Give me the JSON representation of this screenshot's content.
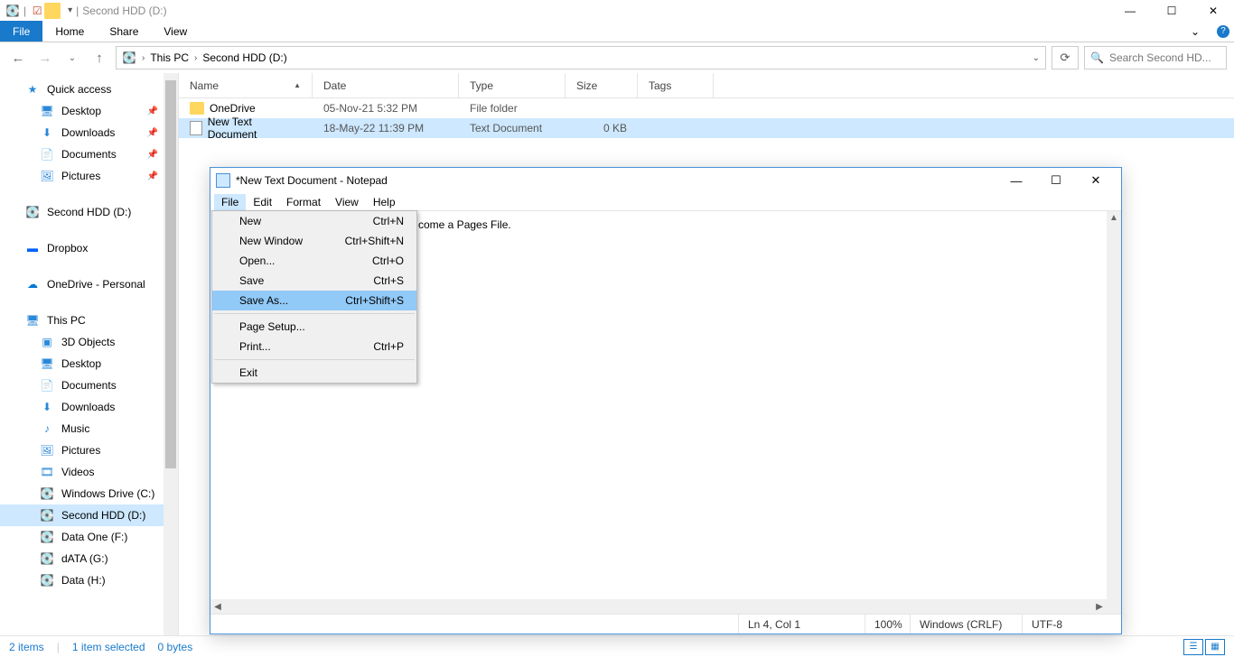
{
  "window": {
    "title": "Second HDD (D:)",
    "min": "—",
    "max": "☐",
    "close": "✕"
  },
  "ribbon": {
    "file": "File",
    "home": "Home",
    "share": "Share",
    "view": "View",
    "dropdown": "⌄"
  },
  "nav": {
    "back": "←",
    "forward": "→",
    "up": "↑",
    "dropdown": "⌄"
  },
  "breadcrumb": {
    "root": "This PC",
    "chev": "›",
    "leaf": "Second HDD (D:)",
    "refresh": "⟳"
  },
  "search": {
    "icon": "🔍",
    "placeholder": "Search Second HD..."
  },
  "cols": {
    "name": "Name",
    "date": "Date",
    "type": "Type",
    "size": "Size",
    "tags": "Tags",
    "arrow": "▲"
  },
  "rows": [
    {
      "name": "OneDrive",
      "date": "05-Nov-21 5:32 PM",
      "type": "File folder",
      "size": "",
      "kind": "folder"
    },
    {
      "name": "New Text Document",
      "date": "18-May-22 11:39 PM",
      "type": "Text Document",
      "size": "0 KB",
      "kind": "file",
      "selected": true
    }
  ],
  "tree": {
    "quick": "Quick access",
    "desktop": "Desktop",
    "downloads": "Downloads",
    "documents": "Documents",
    "pictures": "Pictures",
    "second": "Second HDD (D:)",
    "dropbox": "Dropbox",
    "onedrive": "OneDrive - Personal",
    "thispc": "This PC",
    "tpc": {
      "objs": "3D Objects",
      "desktop": "Desktop",
      "docs": "Documents",
      "dl": "Downloads",
      "music": "Music",
      "pics": "Pictures",
      "vids": "Videos",
      "c": "Windows Drive (C:)",
      "d": "Second HDD (D:)",
      "f": "Data One (F:)",
      "g": "dATA (G:)",
      "h": "Data (H:)"
    }
  },
  "status": {
    "count": "2 items",
    "sel": "1 item selected",
    "bytes": "0 bytes"
  },
  "notepad": {
    "title": "*New Text Document - Notepad",
    "menu": {
      "file": "File",
      "edit": "Edit",
      "format": "Format",
      "view": "View",
      "help": "Help"
    },
    "body_visible": "come a Pages File.",
    "status": {
      "pos": "Ln 4, Col 1",
      "zoom": "100%",
      "eol": "Windows (CRLF)",
      "enc": "UTF-8"
    }
  },
  "dropdown": [
    {
      "label": "New",
      "shortcut": "Ctrl+N"
    },
    {
      "label": "New Window",
      "shortcut": "Ctrl+Shift+N"
    },
    {
      "label": "Open...",
      "shortcut": "Ctrl+O"
    },
    {
      "label": "Save",
      "shortcut": "Ctrl+S"
    },
    {
      "label": "Save As...",
      "shortcut": "Ctrl+Shift+S",
      "hl": true
    },
    {
      "sep": true
    },
    {
      "label": "Page Setup..."
    },
    {
      "label": "Print...",
      "shortcut": "Ctrl+P"
    },
    {
      "sep": true
    },
    {
      "label": "Exit"
    }
  ]
}
